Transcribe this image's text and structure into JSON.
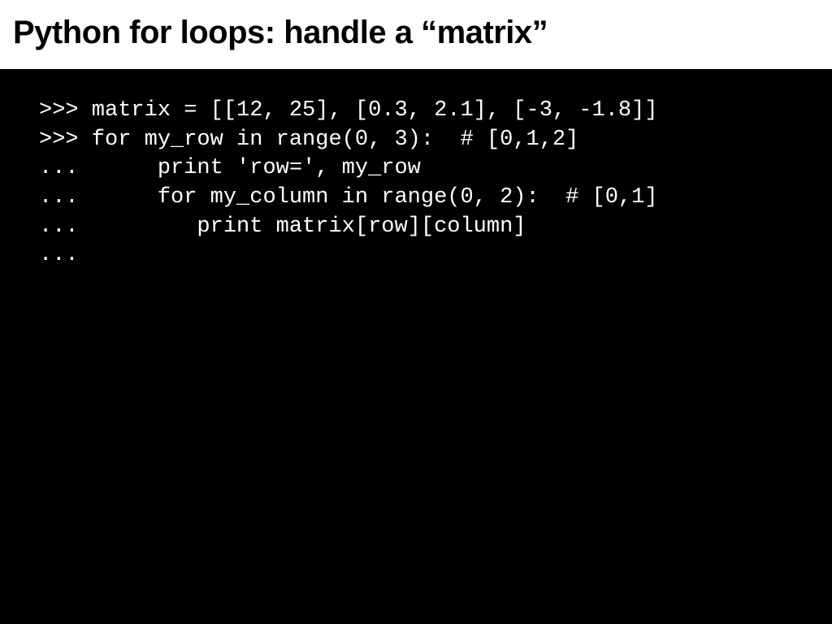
{
  "slide": {
    "title": "Python for loops: handle a “matrix”",
    "code_lines": [
      ">>> matrix = [[12, 25], [0.3, 2.1], [-3, -1.8]]",
      ">>> for my_row in range(0, 3):  # [0,1,2]",
      "...      print 'row=', my_row",
      "...      for my_column in range(0, 2):  # [0,1]",
      "...         print matrix[row][column]",
      "..."
    ]
  }
}
